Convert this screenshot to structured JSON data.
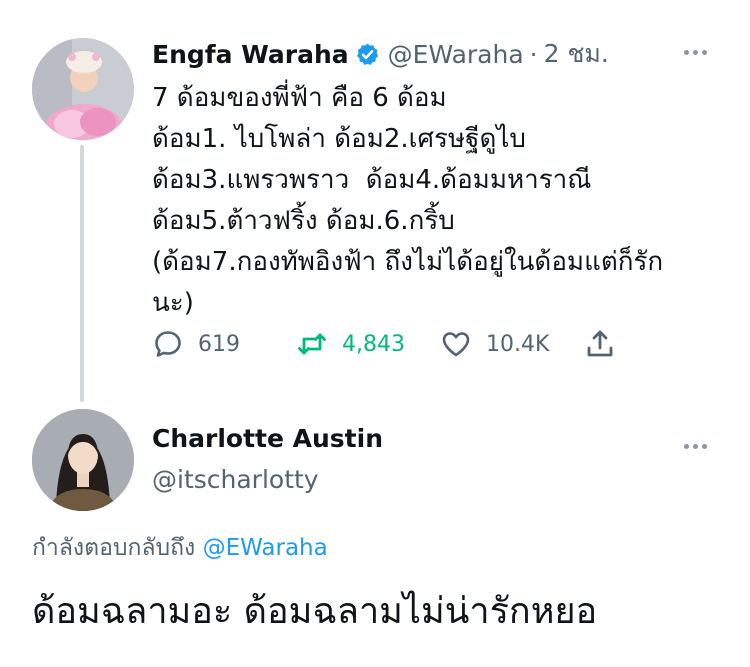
{
  "colors": {
    "accent": "#1d9bf0",
    "retweet": "#00ba7c",
    "muted": "#536471",
    "text": "#0f1419"
  },
  "tweet1": {
    "name": "Engfa Waraha",
    "handle": "@EWaraha",
    "separator": "·",
    "time": "2 ชม.",
    "text": "7 ด้อมของพี่ฟ้า คือ 6 ด้อม\nด้อม1. ไบโพล่า ด้อม2.เศรษฐีดูไบ\nด้อม3.แพรวพราว  ด้อม4.ด้อมมหาราณี\nด้อม5.ต้าวฟริ้ง ด้อม.6.กริ้บ\n(ด้อม7.กองทัพอิงฟ้า ถึงไม่ได้อยู่ในด้อมแต่ก็รัก\nนะ)",
    "stats": {
      "replies": "619",
      "retweets": "4,843",
      "likes": "10.4K"
    }
  },
  "tweet2": {
    "name": "Charlotte Austin",
    "handle": "@itscharlotty",
    "replying_prefix": "กำลังตอบกลับถึง",
    "replying_to": "@EWaraha",
    "text": "ด้อมฉลามอะ ด้อมฉลามไม่น่ารักหยอ"
  },
  "icons": [
    "verified-badge-icon",
    "more-icon",
    "reply-icon",
    "retweet-icon",
    "like-icon",
    "share-icon"
  ]
}
